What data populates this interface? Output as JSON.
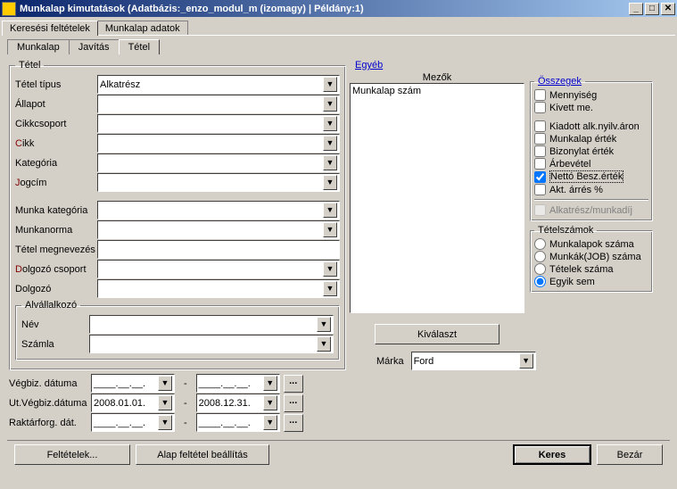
{
  "title": "Munkalap kimutatások   (Adatbázis:_enzo_modul_m (izomagy) | Példány:1)",
  "outer_tabs": {
    "search": "Keresési feltételek",
    "data": "Munkalap adatok"
  },
  "inner_tabs": {
    "munkalap": "Munkalap",
    "javitas": "Javítás",
    "tetel": "Tétel"
  },
  "group": {
    "tetel": "Tétel",
    "alvallalkozo": "Alvállalkozó",
    "osszegek": "Összegek",
    "tetelszamok": "Tételszámok"
  },
  "labels": {
    "tetel_tipus": "Tétel típus",
    "allapot": "Állapot",
    "cikkcsoport": "Cikkcsoport",
    "cikk": "Cikk",
    "kategoria": "Kategória",
    "jogcim": "Jogcím",
    "munka_kategoria": "Munka kategória",
    "munkanorma": "Munkanorma",
    "tetel_megnev": "Tétel megnevezés",
    "dolgozo_csoport": "Dolgozó csoport",
    "dolgozo": "Dolgozó",
    "nev": "Név",
    "szamla": "Számla",
    "vegbiz_datuma": "Végbiz. dátuma",
    "ut_vegbiz_datuma": "Ut.Végbiz.dátuma",
    "raktarforg_dat": "Raktárforg. dát.",
    "marka": "Márka"
  },
  "values": {
    "tetel_tipus": "Alkatrész",
    "ut_from": "2008.01.01.",
    "ut_to": "2008.12.31.",
    "blank_date": "____.__.__.",
    "marka": "Ford"
  },
  "right": {
    "egyeb": "Egyéb",
    "mezok": "Mezők",
    "listitem": "Munkalap szám",
    "kivalaszt": "Kiválaszt"
  },
  "osszegek": {
    "mennyiseg": "Mennyiség",
    "kivett_me": "Kivett me.",
    "kiadott": "Kiadott alk.nyilv.áron",
    "munkalap_ertek": "Munkalap érték",
    "bizonylat_ertek": "Bizonylat érték",
    "arbevetel": "Árbevétel",
    "netto_besz": "Nettó Besz.érték",
    "akt_arres": "Akt. árrés %",
    "alkatresz_munkadij": "Alkatrész/munkadíj"
  },
  "tetelszamok": {
    "munkalapok": "Munkalapok száma",
    "munkak": "Munkák(JOB) száma",
    "tetelek": "Tételek száma",
    "egyik_sem": "Egyik sem"
  },
  "buttons": {
    "feltetelek": "Feltételek...",
    "alap": "Alap feltétel beállítás",
    "keres": "Keres",
    "bezar": "Bezár",
    "dots": "..."
  }
}
